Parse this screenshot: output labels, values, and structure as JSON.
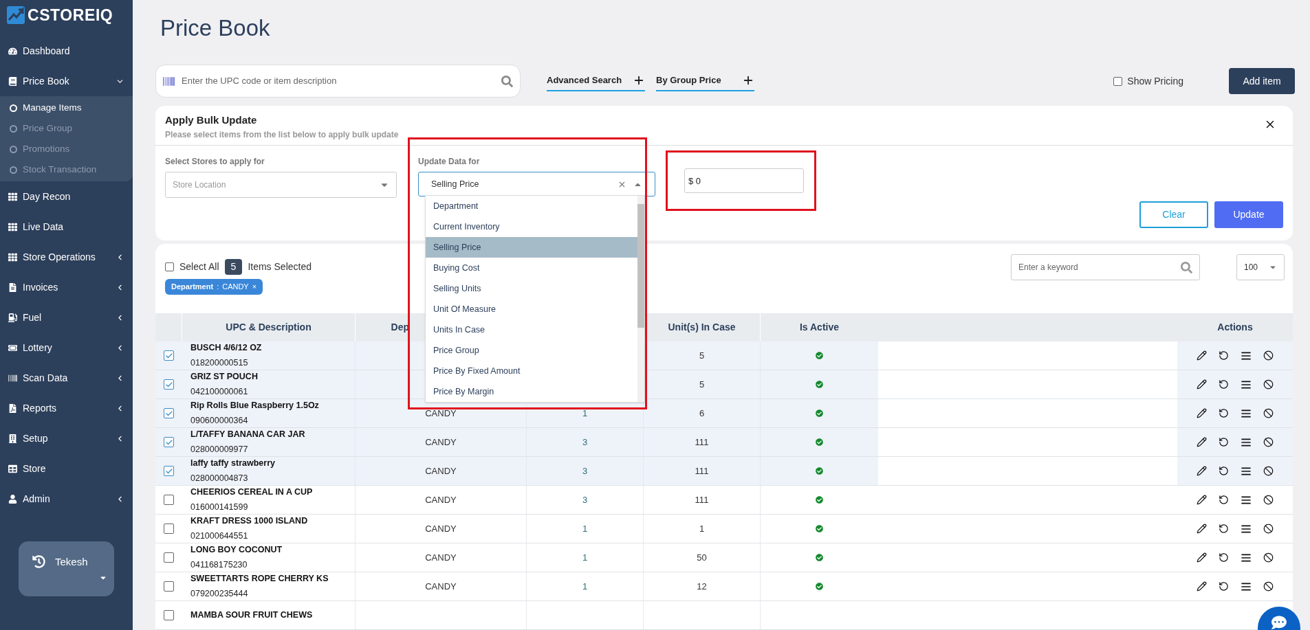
{
  "logo": {
    "text": "CSTOREIQ"
  },
  "sidebar": {
    "items": [
      {
        "label": "Dashboard",
        "expandable": false
      },
      {
        "label": "Price Book",
        "expandable": true,
        "expanded": true,
        "children": [
          {
            "label": "Manage Items",
            "selected": true
          },
          {
            "label": "Price Group",
            "selected": false
          },
          {
            "label": "Promotions",
            "selected": false
          },
          {
            "label": "Stock Transaction",
            "selected": false
          }
        ]
      },
      {
        "label": "Day Recon",
        "expandable": false
      },
      {
        "label": "Live Data",
        "expandable": false
      },
      {
        "label": "Store Operations",
        "expandable": true,
        "expanded": false
      },
      {
        "label": "Invoices",
        "expandable": true,
        "expanded": false
      },
      {
        "label": "Fuel",
        "expandable": true,
        "expanded": false
      },
      {
        "label": "Lottery",
        "expandable": true,
        "expanded": false
      },
      {
        "label": "Scan Data",
        "expandable": true,
        "expanded": false
      },
      {
        "label": "Reports",
        "expandable": true,
        "expanded": false
      },
      {
        "label": "Setup",
        "expandable": true,
        "expanded": false
      },
      {
        "label": "Store",
        "expandable": false
      },
      {
        "label": "Admin",
        "expandable": true,
        "expanded": false
      }
    ],
    "user": {
      "name": "Tekesh"
    }
  },
  "page_title": "Price Book",
  "search": {
    "placeholder": "Enter the UPC code or item description"
  },
  "advanced_search": "Advanced Search",
  "by_group_price": "By Group Price",
  "show_pricing": {
    "label": "Show Pricing",
    "checked": false
  },
  "add_item": "Add item",
  "bulk_update": {
    "title": "Apply Bulk Update",
    "subtitle": "Please select items from the list below to apply bulk update",
    "stores_label": "Select Stores to apply for",
    "stores_placeholder": "Store Location",
    "update_label": "Update Data for",
    "update_value": "Selling Price",
    "options": [
      {
        "label": "Department",
        "selected": false
      },
      {
        "label": "Current Inventory",
        "selected": false
      },
      {
        "label": "Selling Price",
        "selected": true
      },
      {
        "label": "Buying Cost",
        "selected": false
      },
      {
        "label": "Selling Units",
        "selected": false
      },
      {
        "label": "Unit Of Measure",
        "selected": false
      },
      {
        "label": "Units In Case",
        "selected": false
      },
      {
        "label": "Price Group",
        "selected": false
      },
      {
        "label": "Price By Fixed Amount",
        "selected": false
      },
      {
        "label": "Price By Margin",
        "selected": false
      }
    ],
    "amount": "$ 0",
    "clear": "Clear",
    "update": "Update"
  },
  "list": {
    "select_all": {
      "label": "Select All",
      "checked": false
    },
    "selected_count": "5",
    "selected_label": "Items Selected",
    "filter_chip": {
      "field": "Department",
      "separator": ":",
      "value": "CANDY",
      "remove": "×"
    },
    "keyword_placeholder": "Enter a keyword",
    "page_size": "100"
  },
  "table": {
    "columns": {
      "upc": "UPC & Description",
      "department": "Dep",
      "units_in_case": "Unit(s) In Case",
      "is_active": "Is Active",
      "actions": "Actions"
    },
    "rows": [
      {
        "checked": true,
        "name": "BUSCH 4/6/12 OZ",
        "upc": "018200000515",
        "units_in_case": "5",
        "active": true
      },
      {
        "checked": true,
        "name": "GRIZ ST POUCH",
        "upc": "042100000061",
        "units_in_case": "5",
        "active": true
      },
      {
        "checked": true,
        "name": "Rip Rolls Blue Raspberry 1.5Oz",
        "upc": "090600000364",
        "department": "CANDY",
        "column_3": "1",
        "units_in_case": "6",
        "active": true
      },
      {
        "checked": true,
        "name": "L/TAFFY BANANA CAR JAR",
        "upc": "028000009977",
        "department": "CANDY",
        "column_3": "3",
        "units_in_case": "111",
        "active": true
      },
      {
        "checked": true,
        "name": "laffy taffy strawberry",
        "upc": "028000004873",
        "department": "CANDY",
        "column_3": "3",
        "units_in_case": "111",
        "active": true
      },
      {
        "checked": false,
        "name": "CHEERIOS CEREAL IN A CUP",
        "upc": "016000141599",
        "department": "CANDY",
        "column_3": "3",
        "units_in_case": "111",
        "active": true
      },
      {
        "checked": false,
        "name": "KRAFT DRESS 1000 ISLAND",
        "upc": "021000644551",
        "department": "CANDY",
        "column_3": "1",
        "units_in_case": "1",
        "active": true
      },
      {
        "checked": false,
        "name": "LONG BOY COCONUT",
        "upc": "041168175230",
        "department": "CANDY",
        "column_3": "1",
        "units_in_case": "50",
        "active": true
      },
      {
        "checked": false,
        "name": "SWEETTARTS ROPE CHERRY KS",
        "upc": "079200235444",
        "department": "CANDY",
        "column_3": "1",
        "units_in_case": "12",
        "active": true
      },
      {
        "checked": false,
        "name": "MAMBA SOUR FRUIT CHEWS"
      }
    ]
  }
}
